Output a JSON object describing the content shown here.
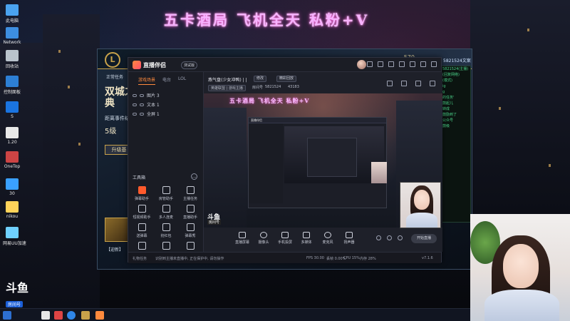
{
  "banner": {
    "text": "五卡酒局 飞机全天 私粉+V"
  },
  "desktop_icons": [
    {
      "label": "此电脑",
      "color": "#4aa3f0"
    },
    {
      "label": "Network",
      "color": "#3d8ee0"
    },
    {
      "label": "回收站",
      "color": "#b9c3cc"
    },
    {
      "label": "控制面板",
      "color": "#2d7fd4"
    },
    {
      "label": "S",
      "color": "#1a74e0"
    },
    {
      "label": "1.20",
      "color": "#e8e8e8"
    },
    {
      "label": "OneTop",
      "color": "#c44"
    },
    {
      "label": "30",
      "color": "#3aa0ff"
    },
    {
      "label": "nikou",
      "color": "#ffd35a"
    },
    {
      "label": "网易UU加速",
      "color": "#6fd0ff"
    }
  ],
  "game": {
    "tab": "正常任务",
    "hero_title": "双城之典",
    "subtitle": "距离事件结",
    "level": "5级",
    "upgrade": "升级基",
    "portrait_caption": "【迎新】",
    "coins": "570"
  },
  "app": {
    "name": "直播伴侣",
    "beta": "测试版",
    "left_tabs": [
      "游戏场景",
      "电台",
      "LOL"
    ],
    "layers": [
      "图片 3",
      "文本 1",
      "全屏 1"
    ],
    "tools_title": "工具箱",
    "tools_more": "…",
    "tools": [
      {
        "label": "弹幕助手",
        "hot": true
      },
      {
        "label": "房管助手",
        "hot": false
      },
      {
        "label": "主播任务",
        "hot": false
      },
      {
        "label": "短视频助手",
        "hot": false
      },
      {
        "label": "多人连麦",
        "hot": false
      },
      {
        "label": "直播助手",
        "hot": false
      },
      {
        "label": "送弹幕",
        "hot": false
      },
      {
        "label": "抢红包",
        "hot": false
      },
      {
        "label": "弹幕秀",
        "hot": false
      },
      {
        "label": "",
        "hot": false
      },
      {
        "label": "",
        "hot": false
      },
      {
        "label": "",
        "hot": false
      }
    ],
    "room_title": "燕气盘(少女冲鸭) | |",
    "edit_btn": "修改",
    "cover_btn": "精彩回放",
    "category": "英雄联盟 | 游戏主播",
    "room_no_label": "房间号",
    "room_no": "5821524",
    "fans": "43183"
  },
  "controls": [
    {
      "label": "直播屏幕",
      "shape": "square"
    },
    {
      "label": "摄像头",
      "shape": "round"
    },
    {
      "label": "手机投屏",
      "shape": "square"
    },
    {
      "label": "多媒体",
      "shape": "square"
    },
    {
      "label": "麦克风",
      "shape": "round"
    },
    {
      "label": "扬声器",
      "shape": "square"
    }
  ],
  "start_button": "开始直播",
  "status": {
    "left": "礼物任务",
    "notice": "识别到主播未直播中, 正在保护中, 请勿操作",
    "bitrate": "码率 0kb/s",
    "fps": "FPS 30.00",
    "drop": "丢帧 0.00%",
    "cpu": "CPU 15%",
    "mem": "内存 28%",
    "version": "v7.1.6"
  },
  "watermark": {
    "logo": "斗鱼",
    "room": "房间号"
  },
  "douyu": {
    "logo": "斗鱼",
    "room_label": "房间号",
    "room_no": "5821524"
  },
  "terminal_lines": [
    "5821524(主播)",
    "(回复网络)",
    "(模式)",
    "",
    "ig ",
    "",
    "g",
    "的任务'",
    "",
    "",
    "鼓起儿",
    "转成",
    "鼓励到了",
    "",
    "公众号",
    "",
    "鼓级"
  ],
  "right_overlay": {
    "top": "5821524文案"
  }
}
